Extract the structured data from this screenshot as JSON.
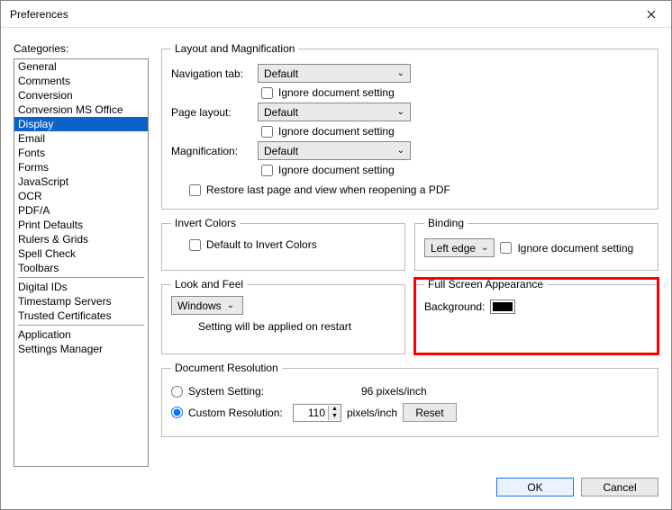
{
  "window": {
    "title": "Preferences"
  },
  "categories": {
    "label": "Categories:",
    "groups": [
      [
        "General",
        "Comments",
        "Conversion",
        "Conversion MS Office",
        "Display",
        "Email",
        "Fonts",
        "Forms",
        "JavaScript",
        "OCR",
        "PDF/A",
        "Print Defaults",
        "Rulers & Grids",
        "Spell Check",
        "Toolbars"
      ],
      [
        "Digital IDs",
        "Timestamp Servers",
        "Trusted Certificates"
      ],
      [
        "Application",
        "Settings Manager"
      ]
    ],
    "selected": "Display"
  },
  "layoutMag": {
    "legend": "Layout and Magnification",
    "navTabLabel": "Navigation tab:",
    "navTab": "Default",
    "ignore": "Ignore document setting",
    "pageLayoutLabel": "Page layout:",
    "pageLayout": "Default",
    "magnificationLabel": "Magnification:",
    "magnification": "Default",
    "restore": "Restore last page and view when reopening a PDF"
  },
  "invert": {
    "legend": "Invert Colors",
    "default": "Default to Invert Colors"
  },
  "binding": {
    "legend": "Binding",
    "value": "Left edge",
    "ignore": "Ignore document setting"
  },
  "look": {
    "legend": "Look and Feel",
    "value": "Windows",
    "note": "Setting will be applied on restart"
  },
  "fullscreen": {
    "legend": "Full Screen Appearance",
    "bgLabel": "Background:",
    "bgColor": "#000000"
  },
  "docres": {
    "legend": "Document Resolution",
    "systemLabel": "System Setting:",
    "systemValue": "96 pixels/inch",
    "customLabel": "Custom Resolution:",
    "customValue": "110",
    "unit": "pixels/inch",
    "reset": "Reset"
  },
  "footer": {
    "ok": "OK",
    "cancel": "Cancel"
  }
}
